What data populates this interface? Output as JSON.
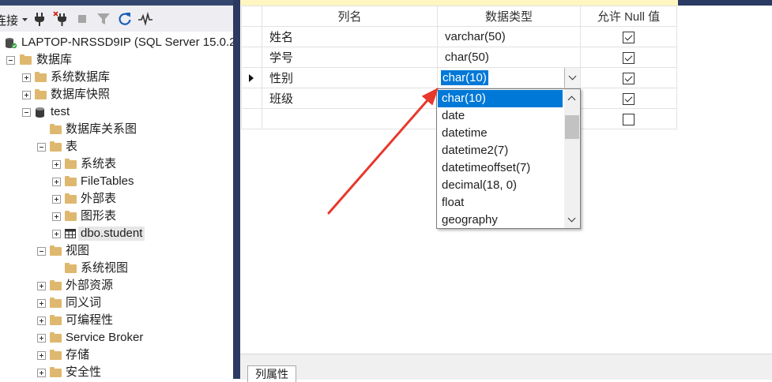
{
  "colors": {
    "accent": "#0078d7",
    "annotation_arrow": "#e8372b",
    "folder": "#dfb86f"
  },
  "toolbar": {
    "connect_label": "连接",
    "icons": [
      "dropdown-arrow-icon",
      "connect-icon",
      "disconnect-icon",
      "stop-icon",
      "filter-icon",
      "refresh-icon",
      "activity-monitor-icon"
    ]
  },
  "tree": [
    {
      "label": "LAPTOP-NRSSD9IP (SQL Server 15.0.2"
    },
    {
      "label": "数据库"
    },
    {
      "label": "系统数据库"
    },
    {
      "label": "数据库快照"
    },
    {
      "label": "test"
    },
    {
      "label": "数据库关系图"
    },
    {
      "label": "表"
    },
    {
      "label": "系统表"
    },
    {
      "label": "FileTables"
    },
    {
      "label": "外部表"
    },
    {
      "label": "图形表"
    },
    {
      "label": "dbo.student"
    },
    {
      "label": "视图"
    },
    {
      "label": "系统视图"
    },
    {
      "label": "外部资源"
    },
    {
      "label": "同义词"
    },
    {
      "label": "可编程性"
    },
    {
      "label": "Service Broker"
    },
    {
      "label": "存储"
    },
    {
      "label": "安全性"
    }
  ],
  "grid": {
    "headers": [
      "列名",
      "数据类型",
      "允许 Null 值"
    ],
    "rows": [
      {
        "name": "姓名",
        "type": "varchar(50)",
        "allow_null": true
      },
      {
        "name": "学号",
        "type": "char(50)",
        "allow_null": true
      },
      {
        "name": "性别",
        "type": "char(10)",
        "allow_null": true
      },
      {
        "name": "班级",
        "type": "",
        "allow_null": true
      },
      {
        "name": "",
        "type": "",
        "allow_null": false
      }
    ]
  },
  "dropdown": {
    "selected": "char(10)",
    "options": [
      "char(10)",
      "date",
      "datetime",
      "datetime2(7)",
      "datetimeoffset(7)",
      "decimal(18, 0)",
      "float",
      "geography"
    ]
  },
  "bottom_tab": {
    "label": "列属性"
  }
}
